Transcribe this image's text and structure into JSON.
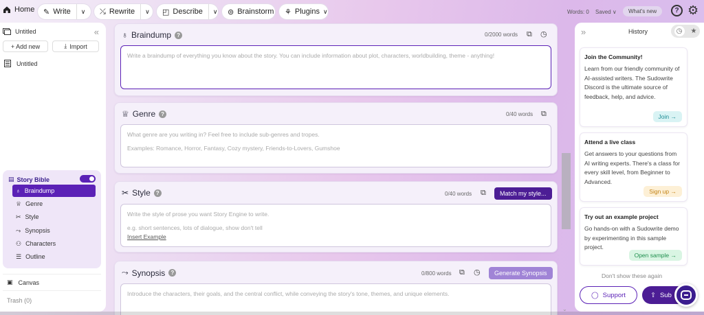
{
  "topbar": {
    "home_label": "Home",
    "write_label": "Write",
    "rewrite_label": "Rewrite",
    "describe_label": "Describe",
    "brainstorm_label": "Brainstorm",
    "plugins_label": "Plugins",
    "words_label": "Words: 0",
    "saved_label": "Saved",
    "whats_new_label": "What's new",
    "help_label": "?"
  },
  "sidebar": {
    "doc_title": "Untitled",
    "add_new_label": "+ Add new",
    "import_label": "Import",
    "documents": [
      "Untitled"
    ],
    "story_bible_label": "Story Bible",
    "story_bible_enabled": true,
    "bible_items": [
      {
        "label": "Braindump",
        "active": true,
        "icon": "brain-icon"
      },
      {
        "label": "Genre",
        "active": false,
        "icon": "trophy-icon"
      },
      {
        "label": "Style",
        "active": false,
        "icon": "style-icon"
      },
      {
        "label": "Synopsis",
        "active": false,
        "icon": "synopsis-icon"
      },
      {
        "label": "Characters",
        "active": false,
        "icon": "characters-icon"
      },
      {
        "label": "Outline",
        "active": false,
        "icon": "list-icon"
      }
    ],
    "canvas_label": "Canvas",
    "trash_label": "Trash (0)"
  },
  "main": {
    "braindump": {
      "title": "Braindump",
      "word_count": "0/2000 words",
      "placeholder": "Write a braindump of everything you know about the story. You can include information about plot, characters, worldbuilding, theme - anything!"
    },
    "genre": {
      "title": "Genre",
      "word_count": "0/40 words",
      "placeholder_line1": "What genre are you writing in? Feel free to include sub-genres and tropes.",
      "placeholder_line2": "Examples: Romance, Horror, Fantasy, Cozy mystery, Friends-to-Lovers, Gumshoe"
    },
    "style": {
      "title": "Style",
      "word_count": "0/40 words",
      "match_button": "Match my style...",
      "placeholder_line1": "Write the style of prose you want Story Engine to write.",
      "placeholder_line2": "e.g. short sentences, lots of dialogue, show don't tell",
      "insert_example": "Insert Example"
    },
    "synopsis": {
      "title": "Synopsis",
      "word_count": "0/800 words",
      "generate_button": "Generate Synopsis",
      "placeholder": "Introduce the characters, their goals, and the central conflict, while conveying the story's tone, themes, and unique elements."
    }
  },
  "history": {
    "title": "History",
    "promos": [
      {
        "heading": "Join the Community!",
        "body": "Learn from our friendly community of AI-assisted writers. The Sudowrite Discord is the ultimate source of feedback, help, and advice.",
        "cta": "Join →"
      },
      {
        "heading": "Attend a live class",
        "body": "Get answers to your questions from AI writing experts. There's a class for every skill level, from Beginner to Advanced.",
        "cta": "Sign up →"
      },
      {
        "heading": "Try out an example project",
        "body": "Go hands-on with a Sudowrite demo by experimenting in this sample project.",
        "cta": "Open sample →"
      }
    ],
    "dont_show": "Don't show these again",
    "support_label": "Support",
    "submit_label": "Sub"
  },
  "colors": {
    "accent": "#5b21b6",
    "accent_dark": "#4c1d95",
    "join": "#1b8c94",
    "signup": "#c28316",
    "sample": "#1f8f4e"
  }
}
